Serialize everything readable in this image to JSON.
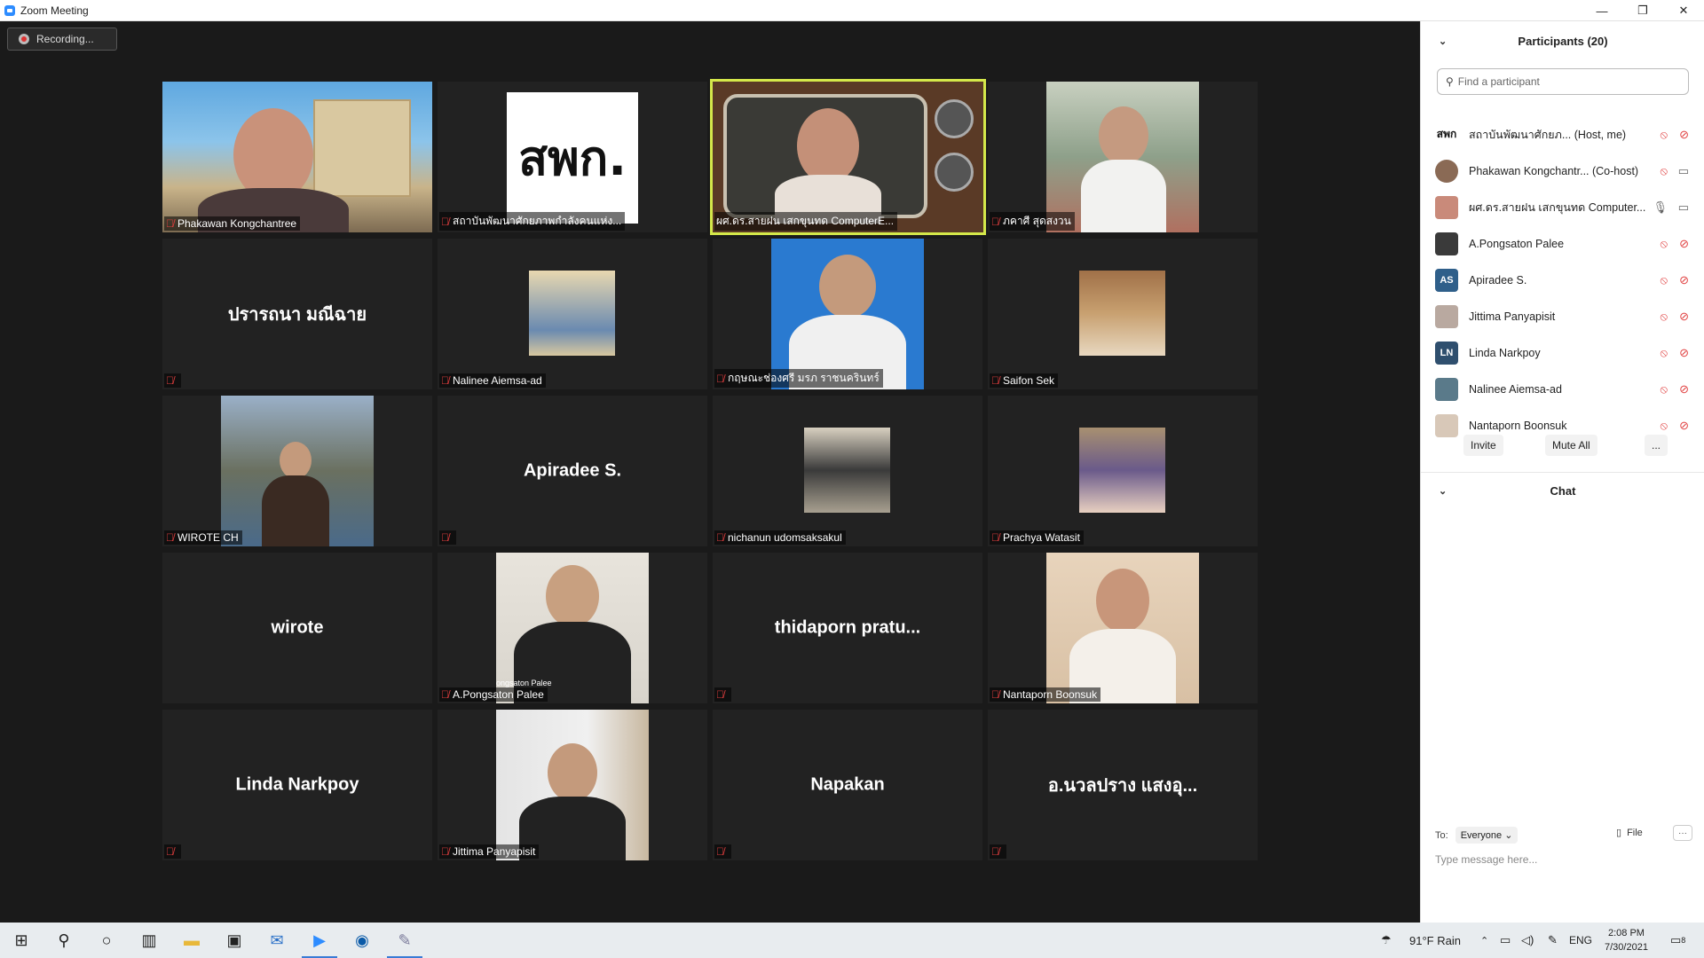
{
  "window": {
    "title": "Zoom Meeting",
    "buttons": [
      "—",
      "❐",
      "✕"
    ]
  },
  "recording": {
    "label": "Recording..."
  },
  "tiles": [
    {
      "label": "Phakawan Kongchantree",
      "display": ""
    },
    {
      "label": "สถาบันพัฒนาศักยภาพกำลังคนแห่ง...",
      "display": "",
      "logo_text": "สพก."
    },
    {
      "label": "ผศ.ดร.สายฝน เสกขุนทด ComputerE...",
      "display": ""
    },
    {
      "label": "ภคาศี สุดสงวน",
      "display": ""
    },
    {
      "label": "",
      "display": "ปรารถนา มณีฉาย"
    },
    {
      "label": "Nalinee Aiemsa-ad",
      "display": ""
    },
    {
      "label": "กฤษณะช่องศรี มรภ ราชนครินทร์",
      "display": ""
    },
    {
      "label": "Saifon Sek",
      "display": ""
    },
    {
      "label": "WIROTE CH",
      "display": ""
    },
    {
      "label": "",
      "display": "Apiradee S."
    },
    {
      "label": "nichanun udomsaksakul",
      "display": ""
    },
    {
      "label": "Prachya Watasit",
      "display": ""
    },
    {
      "label": "",
      "display": "wirote"
    },
    {
      "label": "A.Pongsaton Palee",
      "display": "",
      "overlay": "ongsaton Palee"
    },
    {
      "label": "",
      "display": "thidaporn pratu..."
    },
    {
      "label": "Nantaporn Boonsuk",
      "display": ""
    },
    {
      "label": "",
      "display": "Linda Narkpoy"
    },
    {
      "label": "Jittima Panyapisit",
      "display": ""
    },
    {
      "label": "",
      "display": "Napakan"
    },
    {
      "label": "",
      "display": "อ.นวลปราง แสงอุ..."
    }
  ],
  "panel": {
    "participants_title": "Participants (20)",
    "search_placeholder": "Find a participant",
    "participants": [
      {
        "name": "สถาบันพัฒนาศักยภ... (Host, me)",
        "avatar": "สพก",
        "avatar_color": "#ffffff"
      },
      {
        "name": "Phakawan Kongchantr... (Co-host)",
        "avatar": "",
        "avatar_color": "#8a6a55"
      },
      {
        "name": "ผศ.ดร.สายฝน เสกขุนทด Computer...",
        "avatar": "",
        "avatar_color": "#c98a7a"
      },
      {
        "name": "A.Pongsaton Palee",
        "avatar": "",
        "avatar_color": "#3a3a3a"
      },
      {
        "name": "Apiradee S.",
        "avatar": "AS",
        "avatar_color": "#2f5f8a"
      },
      {
        "name": "Jittima Panyapisit",
        "avatar": "",
        "avatar_color": "#b9a9a0"
      },
      {
        "name": "Linda Narkpoy",
        "avatar": "LN",
        "avatar_color": "#2f4f6e"
      },
      {
        "name": "Nalinee Aiemsa-ad",
        "avatar": "",
        "avatar_color": "#5a7a8a"
      },
      {
        "name": "Nantaporn Boonsuk",
        "avatar": "",
        "avatar_color": "#d8c8b8"
      }
    ],
    "invite_label": "Invite",
    "mute_all_label": "Mute All",
    "more_label": "...",
    "chat_title": "Chat",
    "chat_to_label": "To:",
    "chat_to_value": "Everyone",
    "file_label": "File",
    "chat_placeholder": "Type message here..."
  },
  "taskbar": {
    "weather": "91°F  Rain",
    "lang": "ENG",
    "time": "2:08 PM",
    "date": "7/30/2021",
    "notifications": "8"
  },
  "colors": {
    "accent": "#2d8cff",
    "muted_red": "#e03e3e",
    "active_speaker": "#d4e84a"
  }
}
